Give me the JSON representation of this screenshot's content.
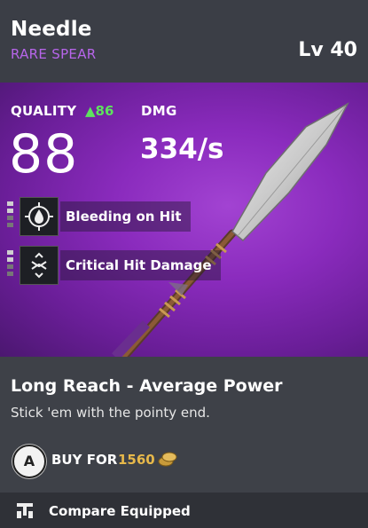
{
  "item": {
    "name": "Needle",
    "rarity": "RARE SPEAR",
    "level": "Lv 40",
    "rarity_color": "#b765ea"
  },
  "stats": {
    "quality_label": "QUALITY",
    "quality_delta": "86",
    "quality_delta_icon": "up-arrow-icon",
    "quality_value": "88",
    "dmg_label": "DMG",
    "dmg_value": "334/s"
  },
  "perks": [
    {
      "label": "Bleeding on Hit",
      "icon": "bleed-icon"
    },
    {
      "label": "Critical Hit Damage",
      "icon": "crit-icon"
    }
  ],
  "description": {
    "ability": "Long Reach - Average Power",
    "flavor": "Stick 'em with the pointy end."
  },
  "buy": {
    "button_glyph": "A",
    "label": "BUY FOR",
    "price": "1560",
    "currency_icon": "coin-icon",
    "price_color": "#e7b84a"
  },
  "footer": {
    "compare_label": "Compare Equipped",
    "compare_icon": "compare-icon"
  },
  "colors": {
    "hero_bg": "#8a2bbd",
    "quality_up": "#5ee35e"
  }
}
